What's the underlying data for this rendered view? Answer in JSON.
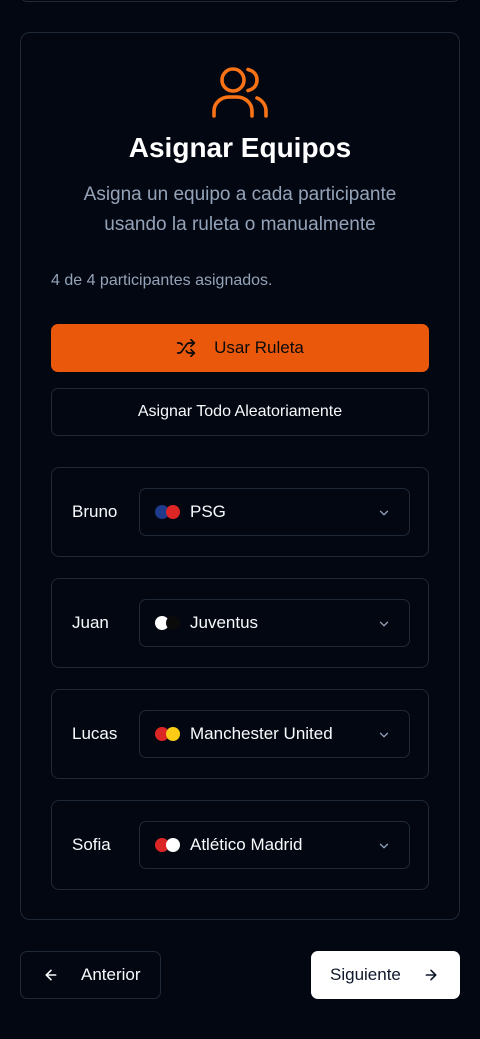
{
  "header": {
    "icon": "users-icon",
    "title": "Asignar Equipos",
    "subtitle": "Asigna un equipo a cada participante usando la ruleta o manualmente"
  },
  "progress_text": "4 de 4 participantes asignados.",
  "actions": {
    "roulette_label": "Usar Ruleta",
    "roulette_icon": "shuffle-icon",
    "random_label": "Asignar Todo Aleatoriamente"
  },
  "participants": [
    {
      "name": "Bruno",
      "team": "PSG",
      "colors": [
        "#1e3a8a",
        "#dc2626"
      ]
    },
    {
      "name": "Juan",
      "team": "Juventus",
      "colors": [
        "#ffffff",
        "#0a0a0a"
      ]
    },
    {
      "name": "Lucas",
      "team": "Manchester United",
      "colors": [
        "#dc2626",
        "#facc15"
      ]
    },
    {
      "name": "Sofia",
      "team": "Atlético Madrid",
      "colors": [
        "#dc2626",
        "#ffffff"
      ]
    }
  ],
  "nav": {
    "prev_label": "Anterior",
    "next_label": "Siguiente"
  },
  "colors": {
    "accent": "#ea580c",
    "background": "#030712",
    "border": "#1f2937",
    "muted_text": "#94a3b8"
  }
}
